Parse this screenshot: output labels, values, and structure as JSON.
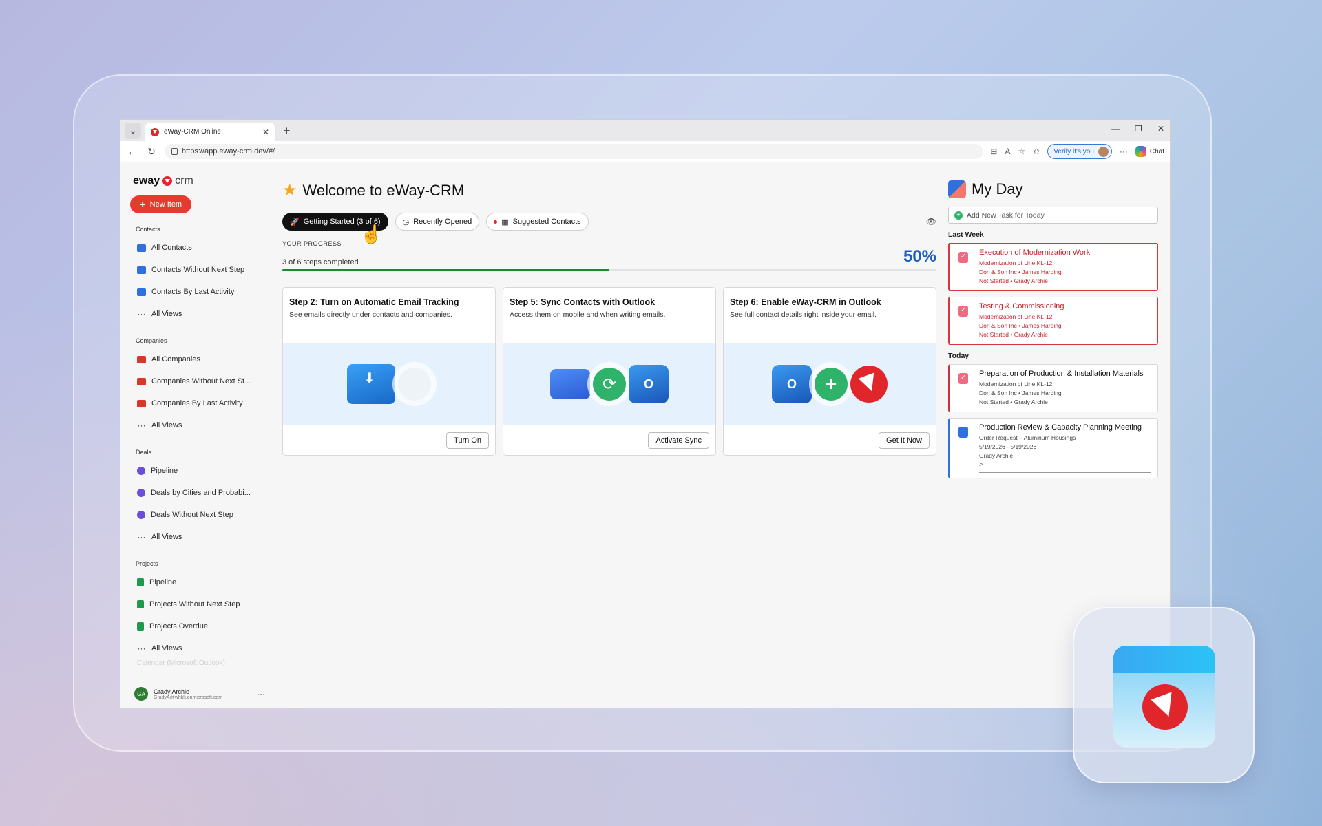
{
  "browser": {
    "tab_title": "eWay-CRM Online",
    "url": "https://app.eway-crm.dev/#/",
    "verify_label": "Verify it's you",
    "chat_label": "Chat"
  },
  "sidebar": {
    "logo_word": "eway",
    "logo_suffix": "crm",
    "new_item": "New Item",
    "contacts_header": "Contacts",
    "contacts": [
      "All Contacts",
      "Contacts Without Next Step",
      "Contacts By Last Activity",
      "All Views"
    ],
    "companies_header": "Companies",
    "companies": [
      "All Companies",
      "Companies Without Next St...",
      "Companies By Last Activity",
      "All Views"
    ],
    "deals_header": "Deals",
    "deals": [
      "Pipeline",
      "Deals by Cities and Probabi...",
      "Deals Without Next Step",
      "All Views"
    ],
    "projects_header": "Projects",
    "projects": [
      "Pipeline",
      "Projects Without Next Step",
      "Projects Overdue",
      "All Views"
    ],
    "calendar_faded": "Calendar (Microsoft Outlook)",
    "user": {
      "initials": "GA",
      "name": "Grady Archie",
      "email": "GradyA@whklt.onmicrosoft.com"
    }
  },
  "main": {
    "title": "Welcome to eWay-CRM",
    "tabs": {
      "getting_started": "Getting Started (3 of 6)",
      "recently_opened": "Recently Opened",
      "suggested_contacts": "Suggested Contacts"
    },
    "progress": {
      "label": "YOUR PROGRESS",
      "steps_text": "3 of 6 steps completed",
      "percent_text": "50%",
      "fraction": 0.5
    },
    "cards": [
      {
        "title": "Step 2: Turn on Automatic Email Tracking",
        "desc": "See emails directly under contacts and companies.",
        "button": "Turn On"
      },
      {
        "title": "Step 5: Sync Contacts with Outlook",
        "desc": "Access them on mobile and when writing emails.",
        "button": "Activate Sync"
      },
      {
        "title": "Step 6: Enable eWay-CRM in Outlook",
        "desc": "See full contact details right inside your email.",
        "button": "Get It Now"
      }
    ]
  },
  "myday": {
    "title": "My Day",
    "add_placeholder": "Add New Task for Today",
    "last_week_label": "Last Week",
    "today_label": "Today",
    "last_week": [
      {
        "title": "Execution of Modernization Work",
        "line1": "Modernization of Line KL-12",
        "line2": "Dorl & Son Inc • James Harding",
        "line3": "Not Started • Grady Archie"
      },
      {
        "title": "Testing & Commissioning",
        "line1": "Modernization of Line KL-12",
        "line2": "Dorl & Son Inc • James Harding",
        "line3": "Not Started • Grady Archie"
      }
    ],
    "today": [
      {
        "title": "Preparation of Production & Installation Materials",
        "line1": "Modernization of Line KL-12",
        "line2": "Dorl & Son Inc • James Harding",
        "line3": "Not Started • Grady Archie"
      },
      {
        "title": "Production Review & Capacity Planning Meeting",
        "line1": "Order Request – Aluminum Housings",
        "line2": "5/19/2026 - 5/19/2026",
        "line3": "Grady Archie",
        "more": ">"
      }
    ]
  }
}
